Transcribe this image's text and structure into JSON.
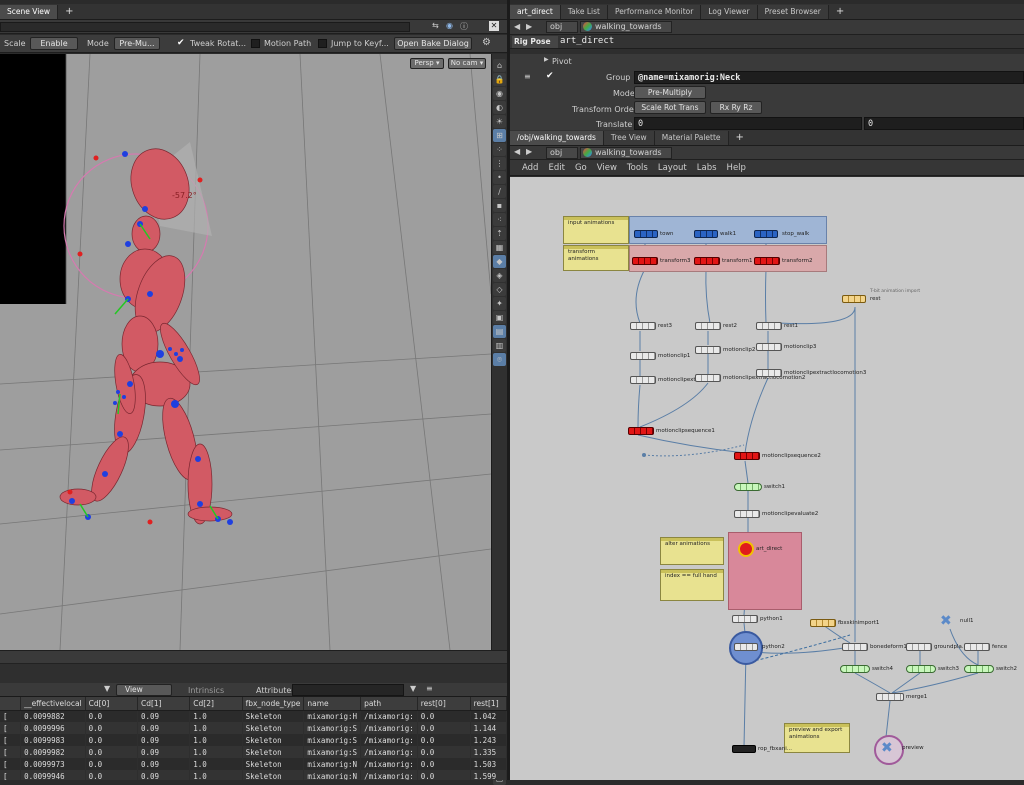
{
  "left_tabs": {
    "tab1": "Scene View",
    "plus": "+"
  },
  "viewer_toolbar": {
    "scale_label": "Scale",
    "scale_value": "Enable",
    "mode_label": "Mode",
    "mode_value": "Pre-Mu...",
    "tweak_label": "Tweak Rotat...",
    "motion_path_label": "Motion Path",
    "jump_label": "Jump to Keyf...",
    "bake_button": "Open Bake Dialog"
  },
  "viewport": {
    "persp_label": "Persp ▾",
    "cam_label": "No cam ▾",
    "angle_readout": "-57.2°"
  },
  "spreadsheet": {
    "view_tab": "View",
    "intrinsics_tab": "Intrinsics",
    "attributes_label": "Attributes:",
    "columns": [
      "",
      "__effectivelocal",
      "Cd[0]",
      "Cd[1]",
      "Cd[2]",
      "fbx_node_type",
      "name",
      "path",
      "rest[0]",
      "rest[1]"
    ],
    "rows": [
      [
        "[",
        "0.0099882",
        "0.0",
        "0.09",
        "1.0",
        "Skeleton",
        "mixamorig:H",
        "/mixamorig:",
        "0.0",
        "1.042"
      ],
      [
        "[",
        "0.0099996",
        "0.0",
        "0.09",
        "1.0",
        "Skeleton",
        "mixamorig:S",
        "/mixamorig:",
        "0.0",
        "1.144"
      ],
      [
        "[",
        "0.0099983",
        "0.0",
        "0.09",
        "1.0",
        "Skeleton",
        "mixamorig:S",
        "/mixamorig:",
        "0.0",
        "1.243"
      ],
      [
        "[",
        "0.0099982",
        "0.0",
        "0.09",
        "1.0",
        "Skeleton",
        "mixamorig:S",
        "/mixamorig:",
        "0.0",
        "1.335"
      ],
      [
        "[",
        "0.0099973",
        "0.0",
        "0.09",
        "1.0",
        "Skeleton",
        "mixamorig:N",
        "/mixamorig:",
        "0.0",
        "1.503"
      ],
      [
        "[",
        "0.0099946",
        "0.0",
        "0.09",
        "1.0",
        "Skeleton",
        "mixamorig:N",
        "/mixamorig:",
        "0.0",
        "1.599"
      ]
    ]
  },
  "right_top_tabs": {
    "tabs": [
      "art_direct",
      "Take List",
      "Performance Monitor",
      "Log Viewer",
      "Preset Browser"
    ],
    "plus": "+"
  },
  "parm_path": {
    "obj": "obj",
    "node": "walking_towards"
  },
  "rigpose": {
    "type_label": "Rig Pose",
    "name": "art_direct",
    "pivot_label": "Pivot",
    "group_label": "Group",
    "group_value": "@name=mixamorig:Neck",
    "mode_label": "Mode",
    "mode_value": "Pre-Multiply",
    "transform_order_label": "Transform Order",
    "transform_order_value": "Scale Rot Trans",
    "rot_order_value": "Rx Ry Rz",
    "translate_label": "Translate",
    "translate_x": "0",
    "translate_y": "0"
  },
  "net_tabs": {
    "tabs": [
      "/obj/walking_towards",
      "Tree View",
      "Material Palette"
    ],
    "plus": "+"
  },
  "net_path": {
    "obj": "obj",
    "node": "walking_towards"
  },
  "net_menu": [
    "Add",
    "Edit",
    "Go",
    "View",
    "Tools",
    "Layout",
    "Labs",
    "Help"
  ],
  "network": {
    "stickies": {
      "input": "input animations",
      "transform": "transform animations",
      "alter": "alter animations",
      "index": "index == full hand",
      "preview_export": "preview and export animations"
    },
    "nodes": {
      "town": "town",
      "walk1": "walk1",
      "stop_walk": "stop_walk",
      "transform3": "transform3",
      "transform1": "transform1",
      "transform2": "transform2",
      "rest_import_caption": "T-bit animation import",
      "rest": "rest",
      "rest3": "rest3",
      "rest2": "rest2",
      "rest1": "rest1",
      "motionclip1": "motionclip1",
      "motionclip2": "motionclip2",
      "motionclip3": "motionclip3",
      "mcextract1": "motionclipextractlo...",
      "mcextract2": "motionclipextractlocomotion2",
      "mcextract3": "motionclipextractlocomotion3",
      "mcsequence1": "motionclipsequence1",
      "mcsequence2": "motionclipsequence2",
      "switch1": "switch1",
      "mcevaluate2": "motionclipevaluate2",
      "art_direct": "art_direct",
      "python1": "python1",
      "fbxskinimport1": "fbxskinimport1",
      "python2": "python2",
      "bonedeform1": "bonedeform1",
      "groundplane": "groundpla...",
      "fence": "fence",
      "null1": "null1",
      "switch4": "switch4",
      "switch3": "switch3",
      "switch2": "switch2",
      "merge1": "merge1",
      "rop_fbx": "rop_fbxani...",
      "preview": "preview"
    }
  }
}
